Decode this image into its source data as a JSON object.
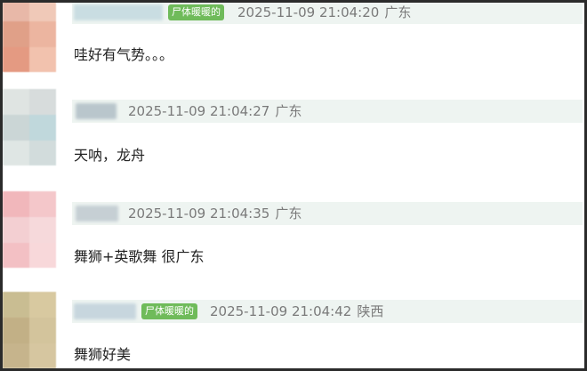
{
  "comments": [
    {
      "badge": "尸体暖暖的",
      "timestamp": "2025-11-09 21:04:20",
      "location": "广东",
      "text": "哇好有气势。。。",
      "avatar_colors": [
        "#e8b8a8",
        "#f0c9b8",
        "#e0a088",
        "#ecb5a0",
        "#e49a82",
        "#f2c2ae"
      ],
      "username_color": "#c9dde2"
    },
    {
      "badge": "",
      "timestamp": "2025-11-09 21:04:27",
      "location": "广东",
      "text": "天呐，龙舟",
      "avatar_colors": [
        "#dfe4e2",
        "#d7dcdc",
        "#cbd6d6",
        "#c0d8dc",
        "#dfe6e4",
        "#d2dcdc"
      ],
      "username_color": "#b9c6cc"
    },
    {
      "badge": "",
      "timestamp": "2025-11-09 21:04:35",
      "location": "广东",
      "text": "舞狮+英歌舞 很广东",
      "avatar_colors": [
        "#f1b7bb",
        "#f4c7ca",
        "#f3cfd2",
        "#f6d9db",
        "#f3c0c4",
        "#f8d8da"
      ],
      "username_color": "#c6cfd4"
    },
    {
      "badge": "尸体暖暖的",
      "timestamp": "2025-11-09 21:04:42",
      "location": "陕西",
      "text": "舞狮好美",
      "avatar_colors": [
        "#c9bd92",
        "#d8c9a0",
        "#c2b086",
        "#d3c49c",
        "#c6b48c",
        "#d6c6a0"
      ],
      "username_color": "#c7d6de"
    }
  ],
  "icons": {
    "avatar": "avatar-image"
  }
}
